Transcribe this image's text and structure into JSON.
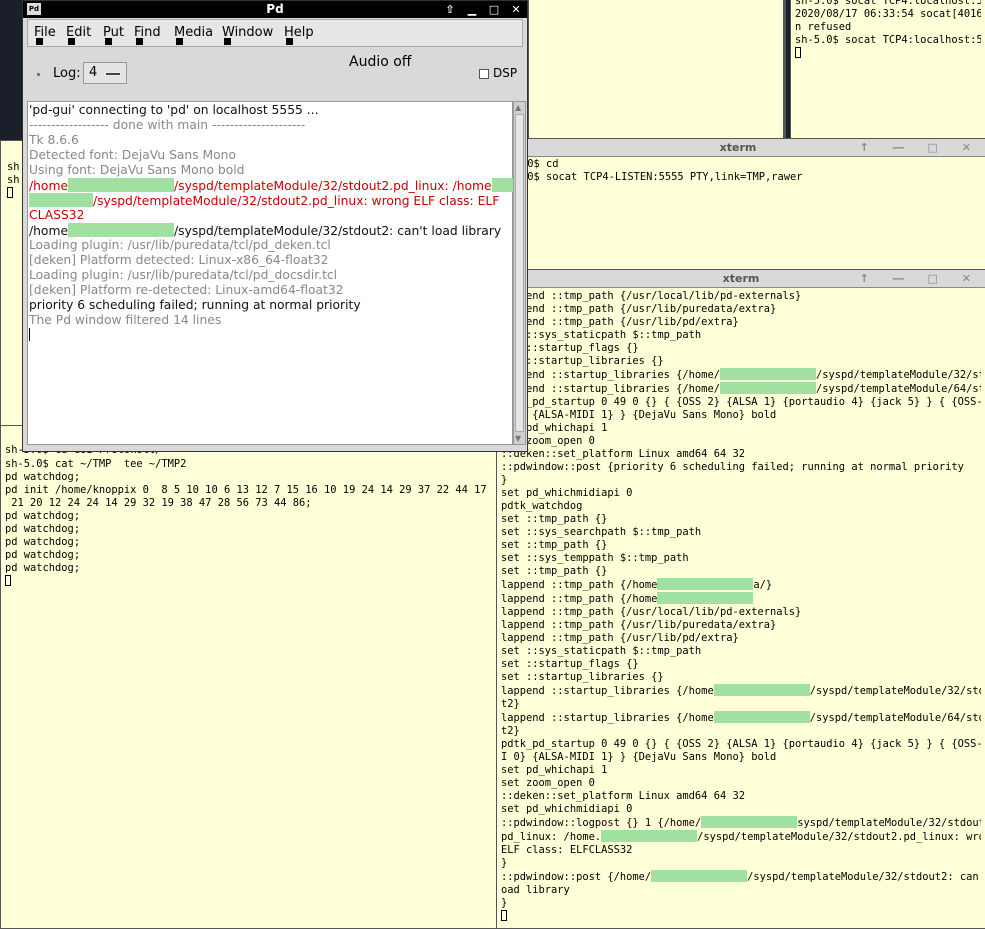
{
  "xterm_top_right": {
    "lines": [
      "sh-5.0$ socat TCP4:localhost:540",
      "2020/08/17 06:33:54 socat[4016]",
      "n refused",
      "sh-5.0$ socat TCP4:localhost:540"
    ]
  },
  "xterm_mid": {
    "title": "xterm",
    "lines": [
      ".0$ cd",
      ".0$ socat TCP4-LISTEN:5555 PTY,link=TMP,rawer"
    ]
  },
  "xterm_left_top": {
    "lines": [
      "sh",
      "sh"
    ]
  },
  "xterm_bottom_left": {
    "lines": [
      "sh-5.0$ cd GUI-Protokoll/",
      "sh-5.0$ cat ~/TMP | tee ~/TMP2",
      "pd watchdog;",
      "pd init /home/knoppix 0  8 5 10 10 6 13 12 7 15 16 10 19 24 14 29 37 22 44 17 10",
      " 21 20 12 24 24 14 29 32 19 38 47 28 56 73 44 86;",
      "pd watchdog;",
      "pd watchdog;",
      "pd watchdog;",
      "pd watchdog;",
      "pd watchdog;"
    ]
  },
  "xterm_right": {
    "title": "xterm",
    "lines": [
      "lappend ::tmp_path {/usr/local/lib/pd-externals}",
      "lappend ::tmp_path {/usr/lib/puredata/extra}",
      "lappend ::tmp_path {/usr/lib/pd/extra}",
      "set ::sys_staticpath $::tmp_path",
      "set ::startup_flags {}",
      "set ::startup_libraries {}",
      "lappend ::startup_libraries {/home/|/syspd/templateModule/32/stdou",
      "",
      "lappend ::startup_libraries {/home/|/syspd/templateModule/64/stdou",
      "",
      "pdtk_pd_startup 0 49 0 {} { {OSS 2} {ALSA 1} {portaudio 4} {jack 5} } { {OSS-MID",
      "I 0} {ALSA-MIDI 1} } {DejaVu Sans Mono} bold",
      "set pd_whichapi 1",
      "set zoom_open 0",
      "::deken::set_platform Linux amd64 64 32",
      "::pdwindow::post {priority 6 scheduling failed; running at normal priority",
      "}",
      "set pd_whichmidiapi 0",
      "pdtk_watchdog",
      "set ::tmp_path {}",
      "set ::sys_searchpath $::tmp_path",
      "set ::tmp_path {}",
      "set ::sys_temppath $::tmp_path",
      "set ::tmp_path {}",
      "lappend ::tmp_path {/home|a/}",
      "lappend ::tmp_path {/home|",
      "lappend ::tmp_path {/usr/local/lib/pd-externals}",
      "lappend ::tmp_path {/usr/lib/puredata/extra}",
      "lappend ::tmp_path {/usr/lib/pd/extra}",
      "set ::sys_staticpath $::tmp_path",
      "set ::startup_flags {}",
      "set ::startup_libraries {}",
      "lappend ::startup_libraries {/home|/syspd/templateModule/32/stdou",
      "t2}",
      "lappend ::startup_libraries {/home|/syspd/templateModule/64/stdou",
      "t2}",
      "pdtk_pd_startup 0 49 0 {} { {OSS 2} {ALSA 1} {portaudio 4} {jack 5} } { {OSS-MID",
      "I 0} {ALSA-MIDI 1} } {DejaVu Sans Mono} bold",
      "set pd_whichapi 1",
      "set zoom_open 0",
      "::deken::set_platform Linux amd64 64 32",
      "set pd_whichmidiapi 0",
      "::pdwindow::logpost {} 1 {/home/|syspd/templateModule/32/stdout2.",
      "pd_linux: /home.|/syspd/templateModule/32/stdout2.pd_linux: wrong",
      "ELF class: ELFCLASS32",
      "}",
      "::pdwindow::post {/home/|/syspd/templateModule/32/stdout2: can't l",
      "oad library",
      "}"
    ]
  },
  "pd": {
    "title": "Pd",
    "menu": [
      "File",
      "Edit",
      "Put",
      "Find",
      "Media",
      "Window",
      "Help"
    ],
    "log_label": "Log:",
    "log_value": "4",
    "audio_status": "Audio off",
    "dsp_label": "DSP",
    "log_lines": [
      {
        "text": "'pd-gui' connecting to 'pd' on localhost 5555 ...",
        "color": "blk"
      },
      {
        "text": "------------------ done with main ---------------------",
        "color": "grey"
      },
      {
        "text": "Tk 8.6.6",
        "color": "grey"
      },
      {
        "text": "Detected font: DejaVu Sans Mono",
        "color": "grey"
      },
      {
        "text": "Using font: DejaVu Sans Mono bold",
        "color": "grey"
      },
      {
        "text": "/home|/syspd/templateModule/32/stdout2.pd_linux: /home|",
        "color": "red"
      },
      {
        "text": "|/syspd/templateModule/32/stdout2.pd_linux: wrong ELF class: ELF",
        "color": "red"
      },
      {
        "text": "CLASS32",
        "color": "red"
      },
      {
        "text": "/home|/syspd/templateModule/32/stdout2: can't load library",
        "color": "blk"
      },
      {
        "text": "Loading plugin: /usr/lib/puredata/tcl/pd_deken.tcl",
        "color": "grey"
      },
      {
        "text": "[deken] Platform detected: Linux-x86_64-float32",
        "color": "grey"
      },
      {
        "text": "Loading plugin: /usr/lib/puredata/tcl/pd_docsdir.tcl",
        "color": "grey"
      },
      {
        "text": "[deken] Platform re-detected: Linux-amd64-float32",
        "color": "grey"
      },
      {
        "text": "priority 6 scheduling failed; running at normal priority",
        "color": "blk"
      },
      {
        "text": "The Pd window filtered 14 lines",
        "color": "grey"
      }
    ]
  }
}
